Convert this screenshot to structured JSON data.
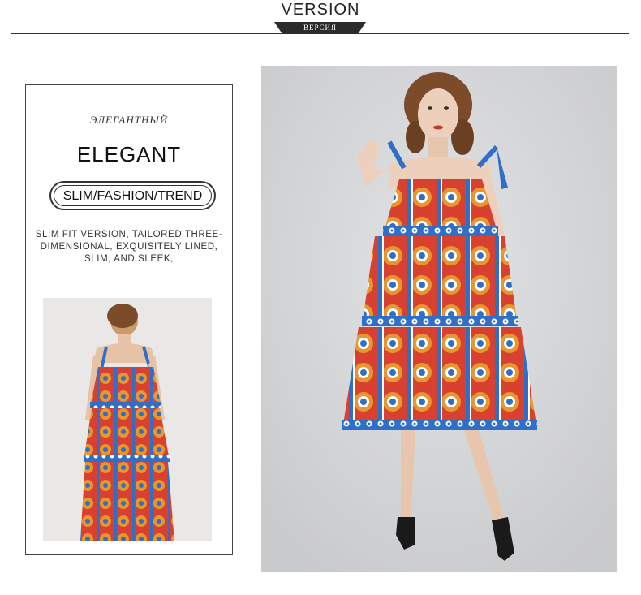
{
  "header": {
    "title": "VERSION",
    "subtitle": "ВЕРСИЯ"
  },
  "card": {
    "russian_word": "ЭЛЕГАНТНЫЙ",
    "english_word": "ELEGANT",
    "tagline": "SLIM/FASHION/TREND",
    "description_lines": [
      "SLIM FIT VERSION, TAILORED THREE-",
      "DIMENSIONAL, EXQUISITELY LINED,",
      "SLIM, AND SLEEK,"
    ]
  },
  "colors": {
    "dress_blue": "#2f6fc7",
    "dress_red": "#d8402f",
    "dress_orange": "#e8962f",
    "main_bg": "#d7d8da",
    "small_bg": "#e9e8e6"
  }
}
